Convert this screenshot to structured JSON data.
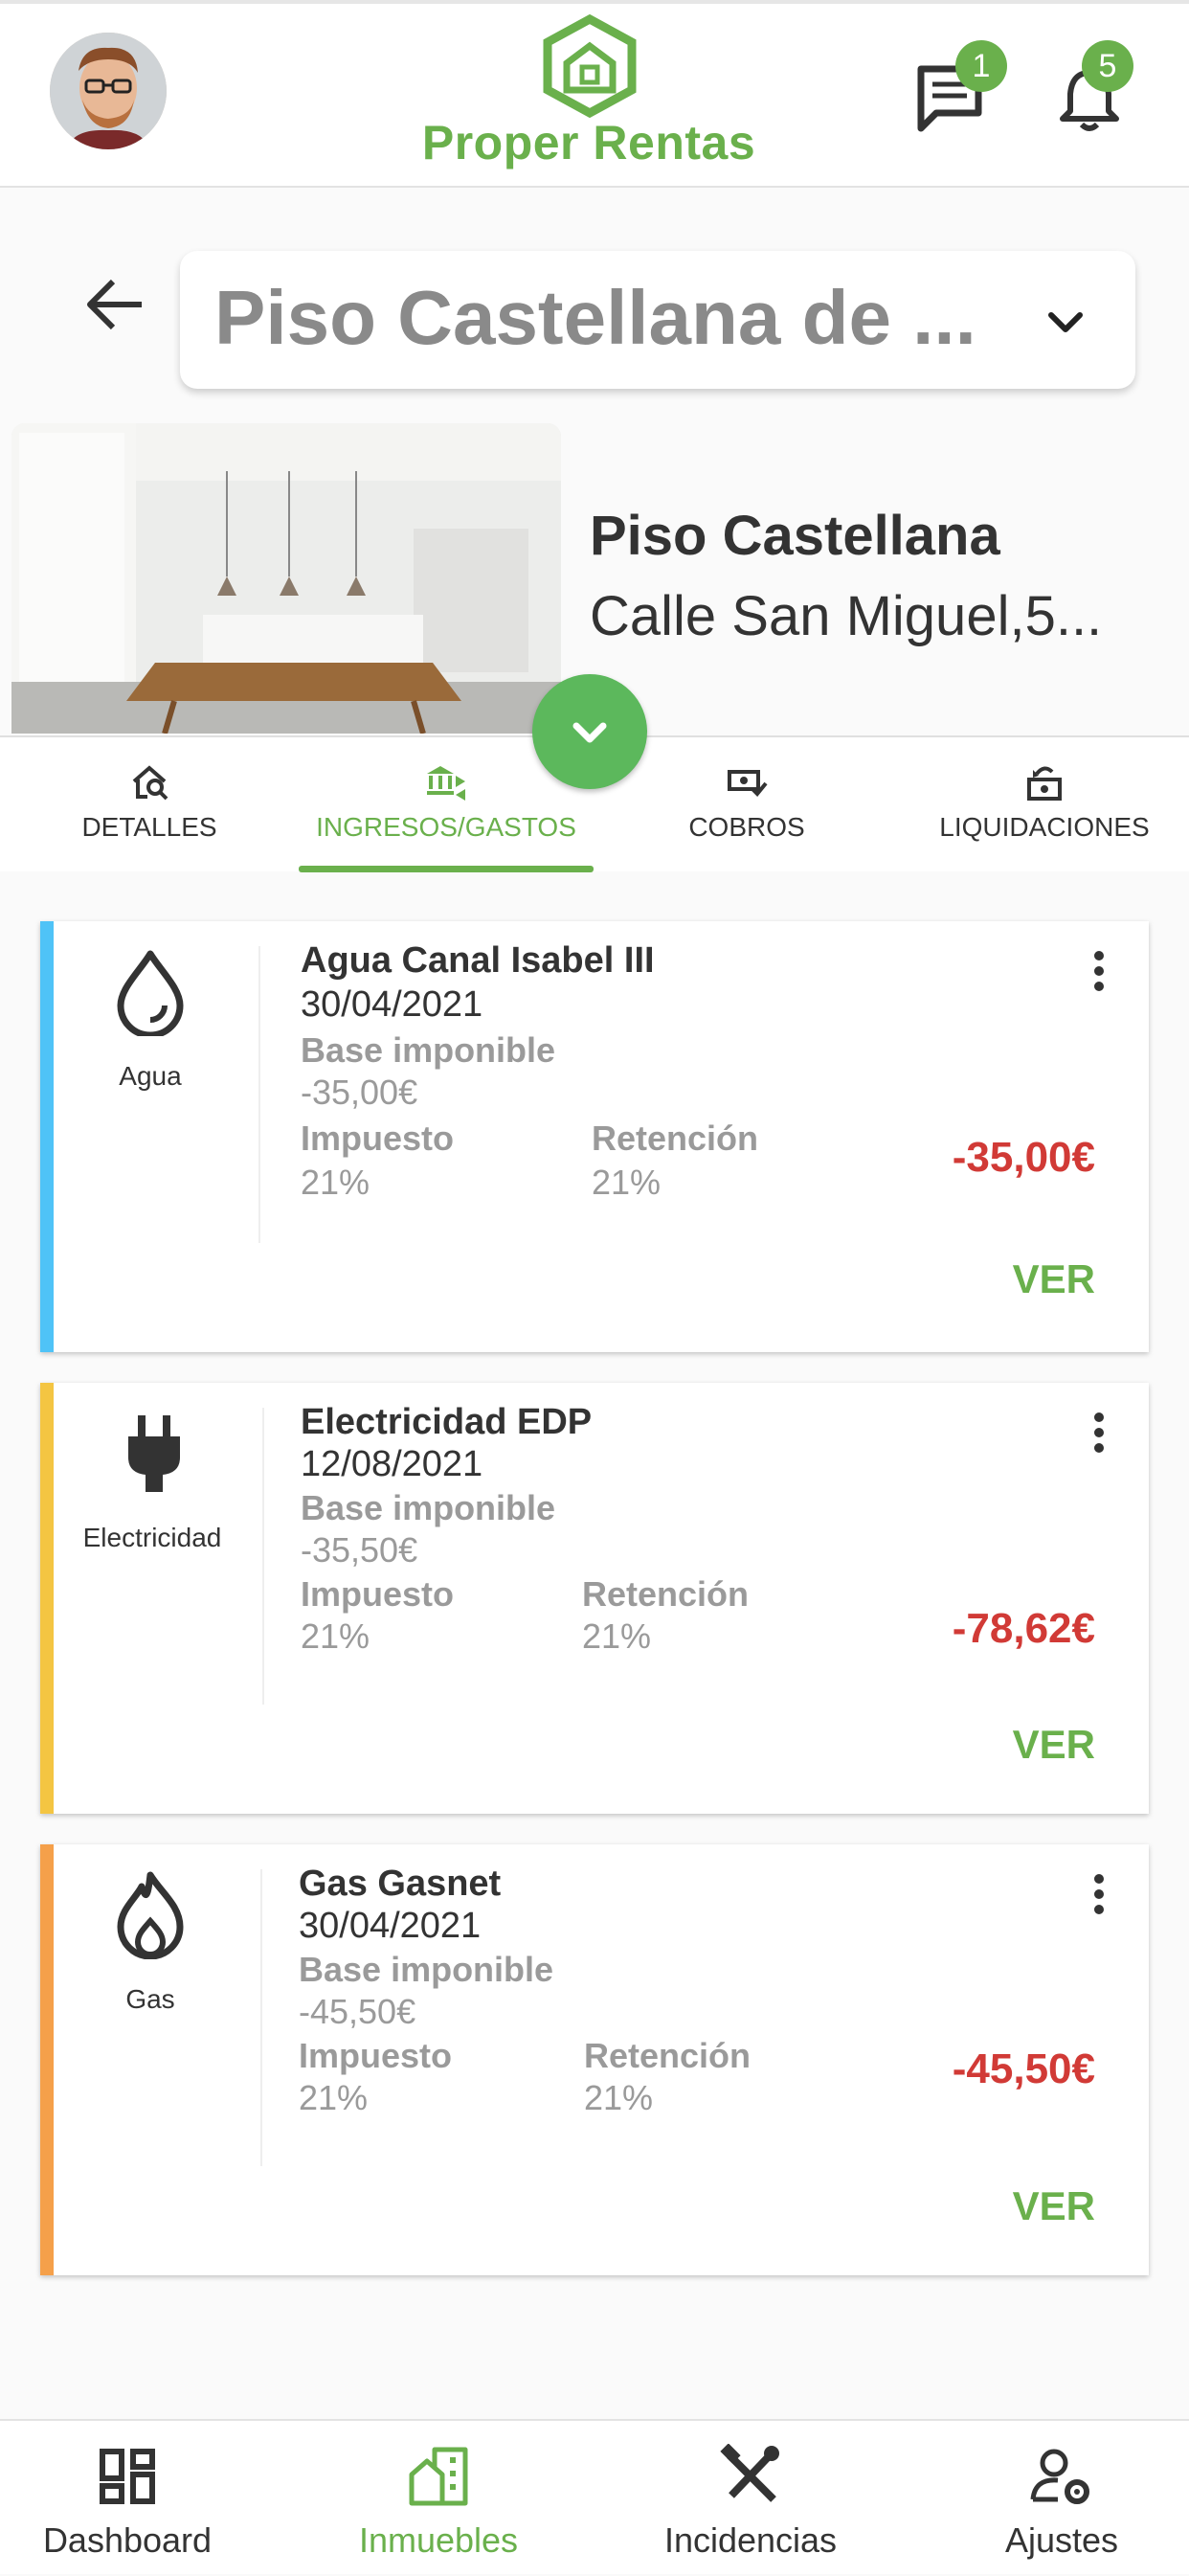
{
  "header": {
    "brand": "Proper Rentas",
    "messages_badge": "1",
    "notifications_badge": "5",
    "brand_color": "#6ab04c"
  },
  "property_selector": {
    "selected": "Piso Castellana de ..."
  },
  "property": {
    "name": "Piso Castellana",
    "address": "Calle San Miguel,5..."
  },
  "tabs": [
    {
      "label": "DETALLES",
      "icon": "home-search-icon"
    },
    {
      "label": "INGRESOS/GASTOS",
      "icon": "bank-transfer-icon",
      "active": true
    },
    {
      "label": "COBROS",
      "icon": "cash-check-icon"
    },
    {
      "label": "LIQUIDACIONES",
      "icon": "cash-refund-icon"
    }
  ],
  "labels": {
    "base": "Base imponible",
    "tax": "Impuesto",
    "retention": "Retención",
    "view": "VER"
  },
  "expenses": [
    {
      "category": "Agua",
      "icon": "water-drop-icon",
      "color": "#4fc3f7",
      "name": "Agua Canal Isabel III",
      "date": "30/04/2021",
      "base": "-35,00€",
      "tax": "21%",
      "retention": "21%",
      "total": "-35,00€"
    },
    {
      "category": "Electricidad",
      "icon": "power-plug-icon",
      "color": "#f4c542",
      "name": "Electricidad EDP",
      "date": "12/08/2021",
      "base": "-35,50€",
      "tax": "21%",
      "retention": "21%",
      "total": "-78,62€"
    },
    {
      "category": "Gas",
      "icon": "fire-icon",
      "color": "#f5a04a",
      "name": "Gas Gasnet",
      "date": "30/04/2021",
      "base": "-45,50€",
      "tax": "21%",
      "retention": "21%",
      "total": "-45,50€"
    }
  ],
  "bottom_nav": [
    {
      "label": "Dashboard",
      "icon": "dashboard-icon"
    },
    {
      "label": "Inmuebles",
      "icon": "building-icon",
      "active": true
    },
    {
      "label": "Incidencias",
      "icon": "tools-icon"
    },
    {
      "label": "Ajustes",
      "icon": "user-settings-icon"
    }
  ]
}
